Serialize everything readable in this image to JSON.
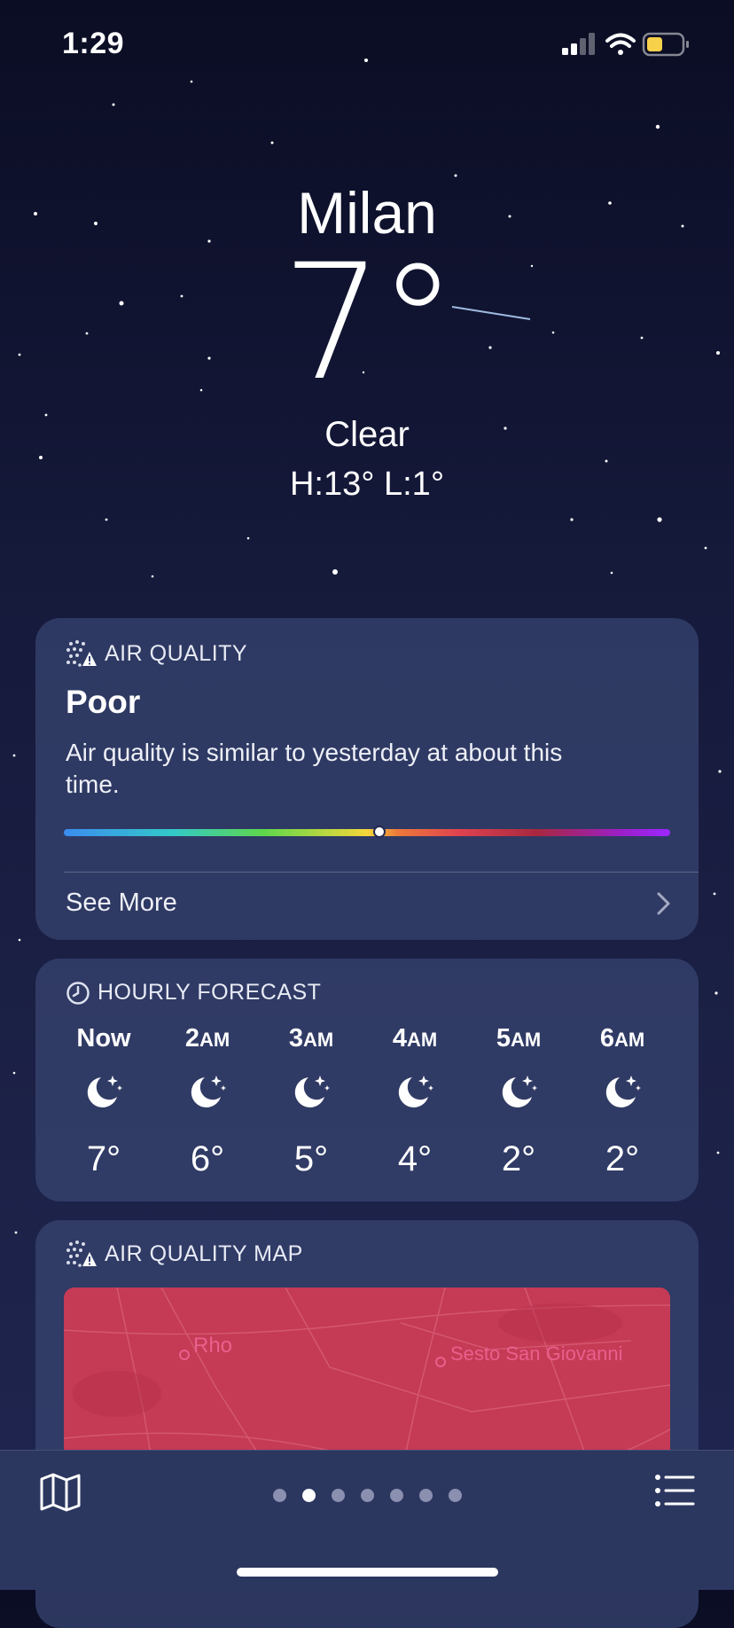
{
  "status": {
    "time": "1:29"
  },
  "hero": {
    "city": "Milan",
    "temperature": "7°",
    "condition": "Clear",
    "high_low": "H:13°  L:1°"
  },
  "air_quality": {
    "heading": "AIR QUALITY",
    "level": "Poor",
    "description": "Air quality is similar to yesterday at about this time.",
    "scale_position": 0.52,
    "see_more": "See More"
  },
  "hourly": {
    "heading": "HOURLY FORECAST",
    "items": [
      {
        "hour": "Now",
        "suffix": "",
        "icon": "moon-stars-icon",
        "temp": "7°"
      },
      {
        "hour": "2",
        "suffix": "AM",
        "icon": "moon-stars-icon",
        "temp": "6°"
      },
      {
        "hour": "3",
        "suffix": "AM",
        "icon": "moon-stars-icon",
        "temp": "5°"
      },
      {
        "hour": "4",
        "suffix": "AM",
        "icon": "moon-stars-icon",
        "temp": "4°"
      },
      {
        "hour": "5",
        "suffix": "AM",
        "icon": "moon-stars-icon",
        "temp": "2°"
      },
      {
        "hour": "6",
        "suffix": "AM",
        "icon": "moon-stars-icon",
        "temp": "2°"
      }
    ]
  },
  "aq_map": {
    "heading": "AIR QUALITY MAP",
    "places": [
      "Rho",
      "Sesto San Giovanni"
    ]
  },
  "pages": {
    "count": 7,
    "active": 1
  },
  "colors": {
    "map": "#c53a55",
    "place_label": "#e8608c"
  }
}
